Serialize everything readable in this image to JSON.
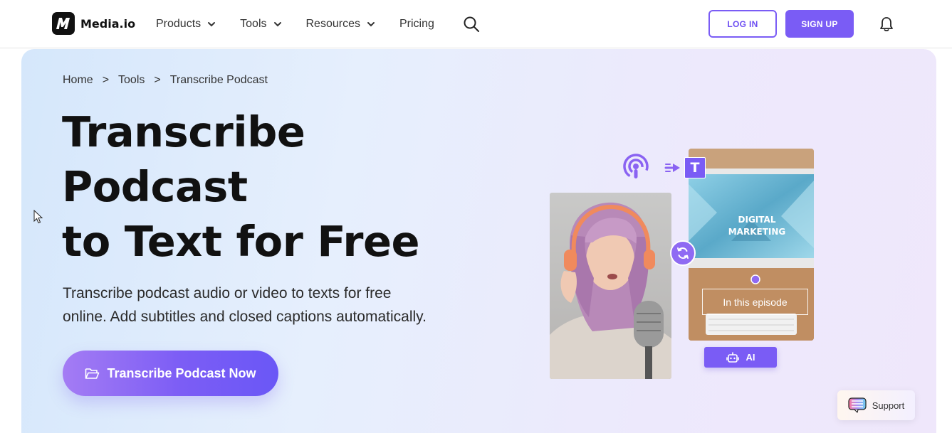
{
  "header": {
    "brand": "Media.io",
    "nav": [
      {
        "label": "Products",
        "has_menu": true
      },
      {
        "label": "Tools",
        "has_menu": true
      },
      {
        "label": "Resources",
        "has_menu": true
      },
      {
        "label": "Pricing",
        "has_menu": false
      }
    ],
    "login_label": "LOG IN",
    "signup_label": "SIGN UP"
  },
  "breadcrumb": {
    "items": [
      "Home",
      "Tools",
      "Transcribe Podcast"
    ],
    "separator": ">"
  },
  "hero": {
    "title_line1": "Transcribe",
    "title_line2": "Podcast",
    "title_line3": "to Text for Free",
    "subtitle_line1": "Transcribe podcast audio or video to texts for free",
    "subtitle_line2": "online. Add subtitles and closed captions automatically.",
    "cta_label": "Transcribe Podcast Now"
  },
  "illustration": {
    "screen_text_line1": "DIGITAL",
    "screen_text_line2": "MARKETING",
    "caption_text": "In this episode",
    "ai_label": "AI",
    "t_glyph": "T"
  },
  "support": {
    "label": "Support"
  },
  "colors": {
    "accent": "#7a5cf5",
    "hero_bg_start": "#d5e7fb",
    "hero_bg_end": "#efe7fb",
    "text_dark": "#111111"
  },
  "icons": [
    "logo-mark-icon",
    "chevron-down-icon",
    "search-icon",
    "bell-icon",
    "folder-open-icon",
    "podcast-icon",
    "arrow-right-icon",
    "text-t-icon",
    "sync-icon",
    "robot-icon",
    "chat-support-icon",
    "mouse-cursor-icon"
  ]
}
